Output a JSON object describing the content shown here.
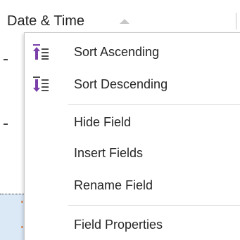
{
  "header": {
    "column_title": "Date & Time"
  },
  "context_menu": {
    "items": [
      {
        "label": "Sort Ascending",
        "icon": "sort-ascending-icon"
      },
      {
        "label": "Sort Descending",
        "icon": "sort-descending-icon"
      },
      {
        "label": "Hide Field"
      },
      {
        "label": "Insert Fields"
      },
      {
        "label": "Rename Field"
      },
      {
        "label": "Field Properties"
      }
    ]
  },
  "colors": {
    "accent_purple": "#7a3fa8",
    "selection_blue": "#dbe8f6",
    "text": "#262626"
  }
}
